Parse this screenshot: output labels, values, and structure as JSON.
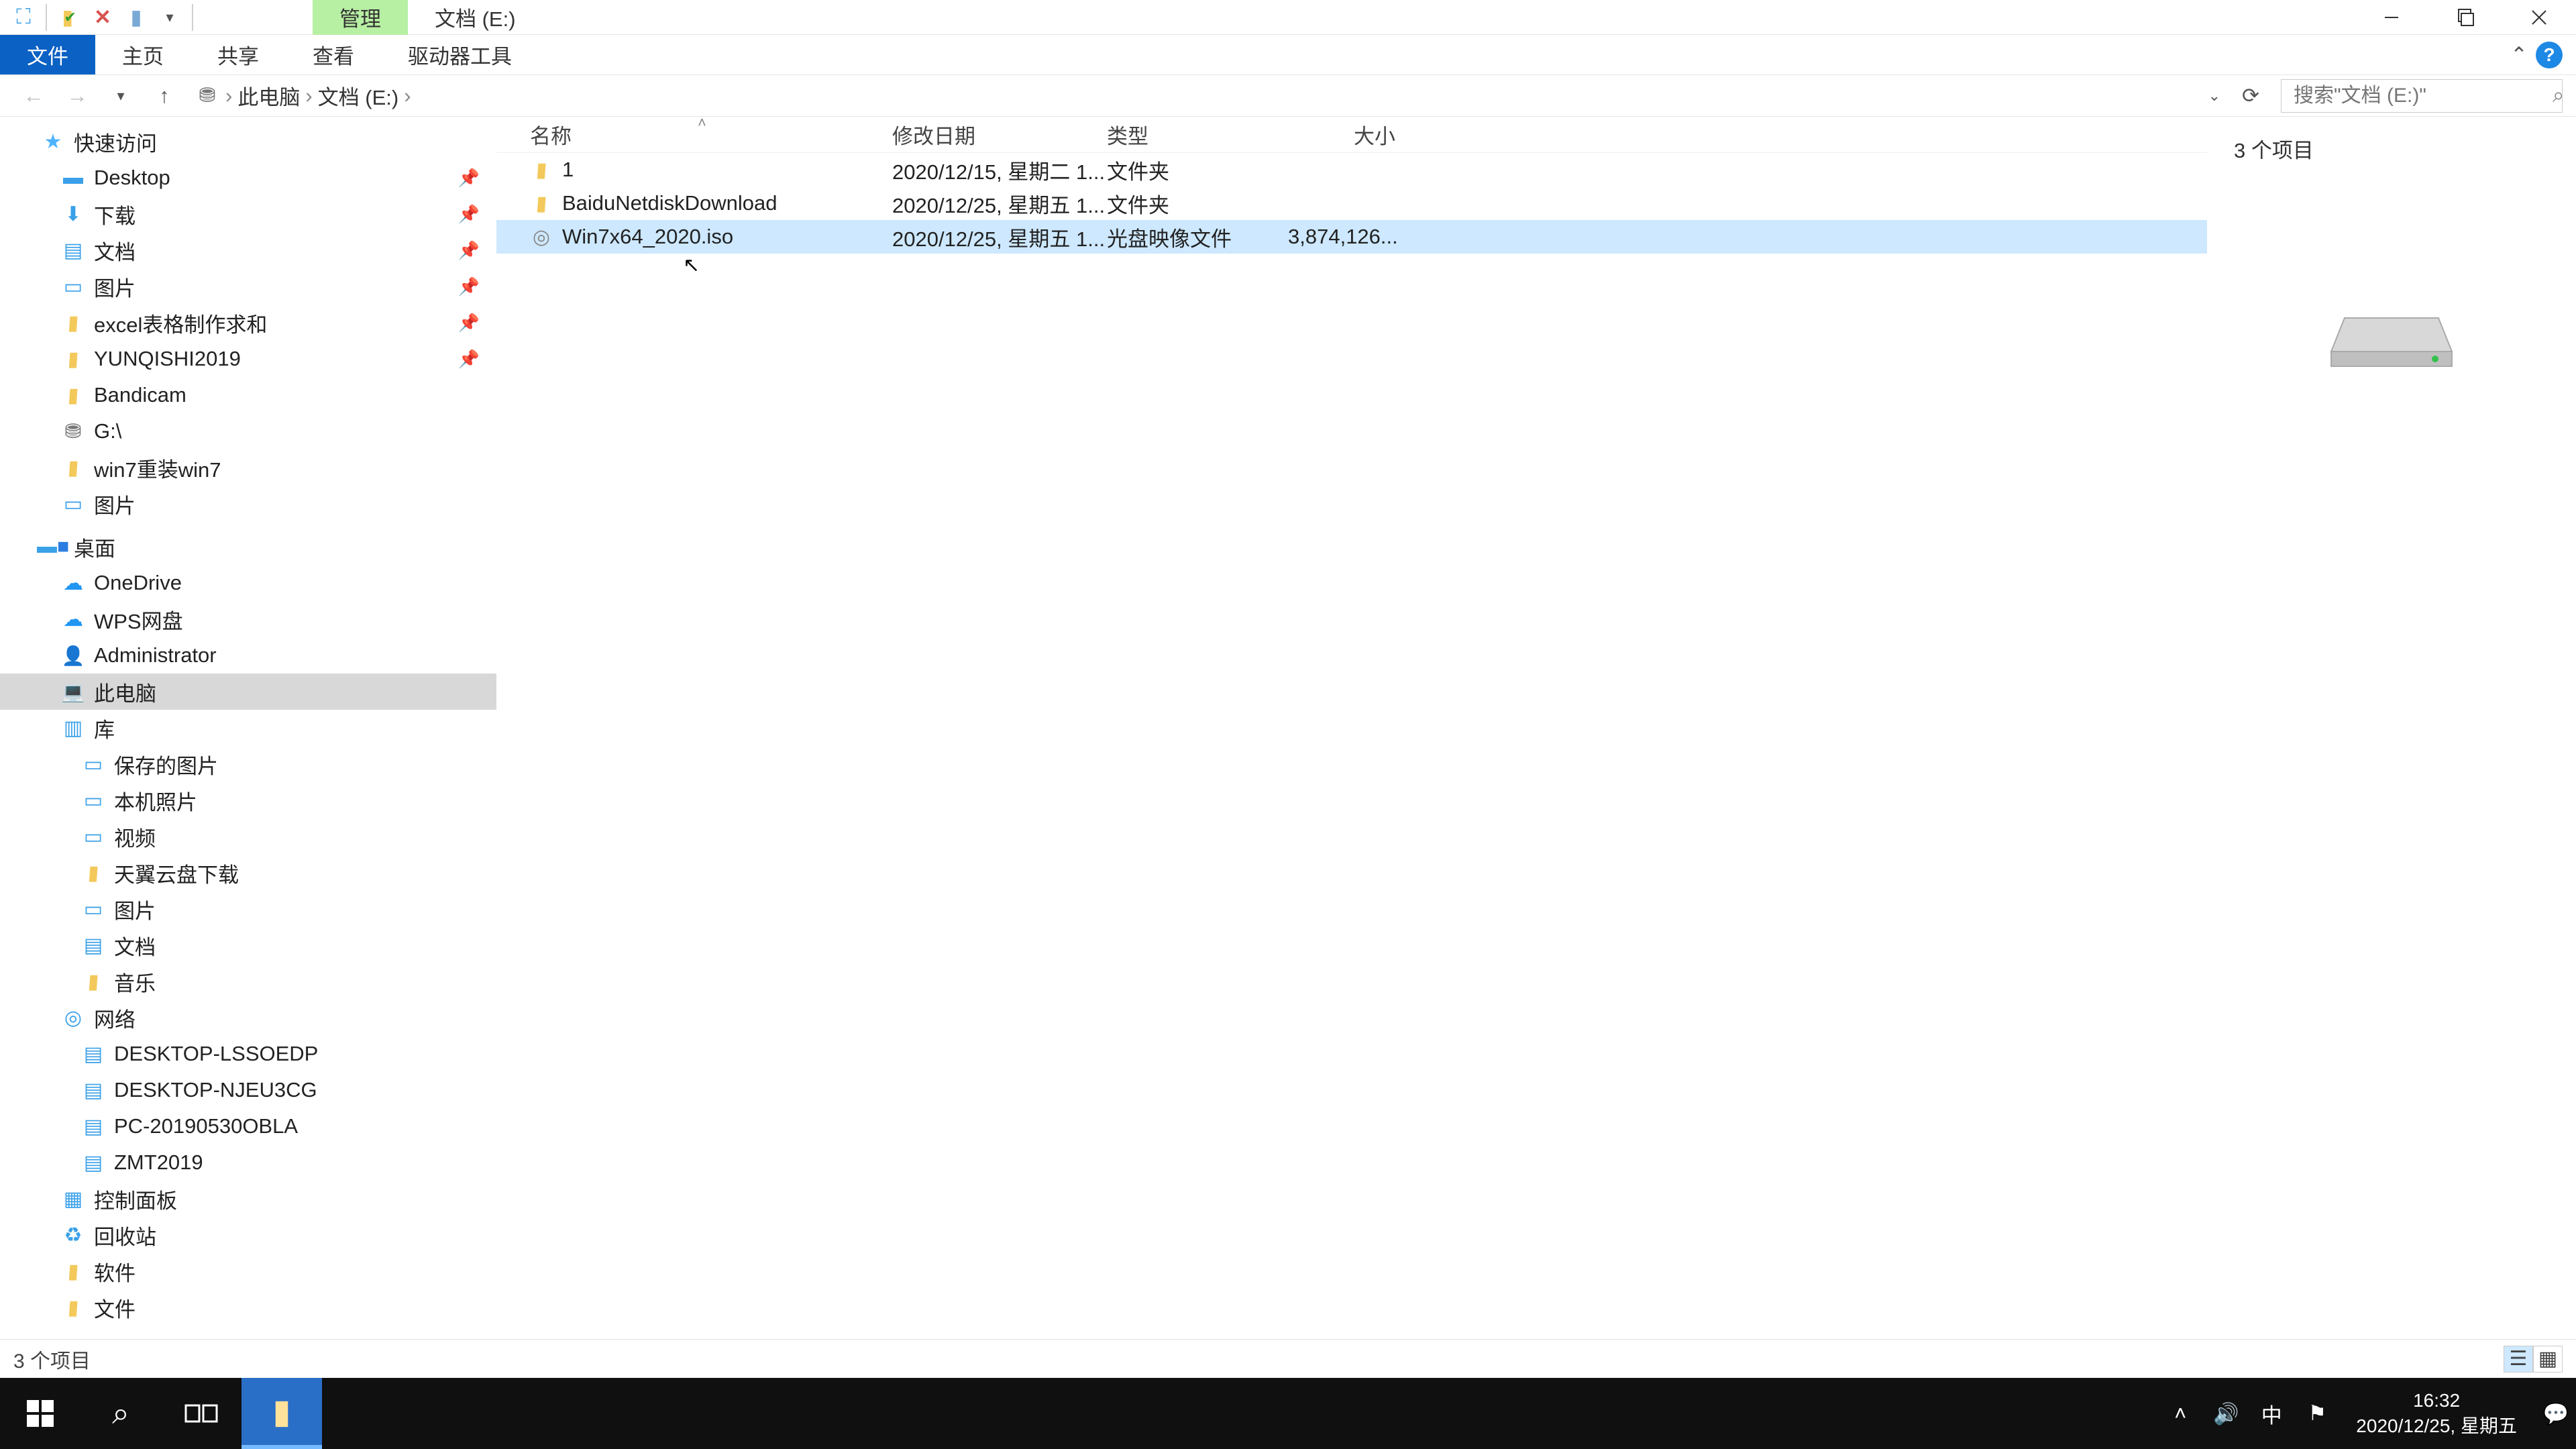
{
  "titlebar": {
    "context_tab": "管理",
    "title": "文档 (E:)"
  },
  "ribbon": {
    "file": "文件",
    "home": "主页",
    "share": "共享",
    "view": "查看",
    "drive_tools": "驱动器工具"
  },
  "address": {
    "crumbs": [
      "此电脑",
      "文档 (E:)"
    ],
    "search_placeholder": "搜索\"文档 (E:)\""
  },
  "nav": {
    "quick_access": "快速访问",
    "quick_items": [
      {
        "icon": "ico-desktop",
        "label": "Desktop",
        "pinned": true
      },
      {
        "icon": "ico-down",
        "label": "下载",
        "pinned": true
      },
      {
        "icon": "ico-doc",
        "label": "文档",
        "pinned": true
      },
      {
        "icon": "ico-pic",
        "label": "图片",
        "pinned": true
      },
      {
        "icon": "ico-folder",
        "label": "excel表格制作求和",
        "pinned": true
      },
      {
        "icon": "ico-folder",
        "label": "YUNQISHI2019",
        "pinned": true
      },
      {
        "icon": "ico-folder",
        "label": "Bandicam",
        "pinned": false
      },
      {
        "icon": "ico-drive",
        "label": "G:\\",
        "pinned": false
      },
      {
        "icon": "ico-folder",
        "label": "win7重装win7",
        "pinned": false
      },
      {
        "icon": "ico-pic",
        "label": "图片",
        "pinned": false
      }
    ],
    "desktop": "桌面",
    "desktop_items": [
      {
        "icon": "ico-onedrive",
        "label": "OneDrive"
      },
      {
        "icon": "ico-wps",
        "label": "WPS网盘"
      },
      {
        "icon": "ico-user",
        "label": "Administrator"
      },
      {
        "icon": "ico-pc",
        "label": "此电脑",
        "selected": true
      },
      {
        "icon": "ico-lib",
        "label": "库"
      }
    ],
    "lib_items": [
      {
        "icon": "ico-pic",
        "label": "保存的图片"
      },
      {
        "icon": "ico-pic",
        "label": "本机照片"
      },
      {
        "icon": "ico-pic",
        "label": "视频"
      },
      {
        "icon": "ico-folder",
        "label": "天翼云盘下载"
      },
      {
        "icon": "ico-pic",
        "label": "图片"
      },
      {
        "icon": "ico-doc",
        "label": "文档"
      },
      {
        "icon": "ico-folder",
        "label": "音乐"
      }
    ],
    "network": "网络",
    "net_items": [
      {
        "icon": "ico-netpc",
        "label": "DESKTOP-LSSOEDP"
      },
      {
        "icon": "ico-netpc",
        "label": "DESKTOP-NJEU3CG"
      },
      {
        "icon": "ico-netpc",
        "label": "PC-20190530OBLA"
      },
      {
        "icon": "ico-netpc",
        "label": "ZMT2019"
      }
    ],
    "tail_items": [
      {
        "icon": "ico-panel",
        "label": "控制面板"
      },
      {
        "icon": "ico-recycle",
        "label": "回收站"
      },
      {
        "icon": "ico-folder",
        "label": "软件"
      },
      {
        "icon": "ico-folder",
        "label": "文件"
      }
    ]
  },
  "columns": {
    "name": "名称",
    "date": "修改日期",
    "type": "类型",
    "size": "大小"
  },
  "rows": [
    {
      "icon": "ico-folder",
      "name": "1",
      "date": "2020/12/15, 星期二 1...",
      "type": "文件夹",
      "size": "",
      "selected": false
    },
    {
      "icon": "ico-folder",
      "name": "BaiduNetdiskDownload",
      "date": "2020/12/25, 星期五 1...",
      "type": "文件夹",
      "size": "",
      "selected": false
    },
    {
      "icon": "ico-iso",
      "name": "Win7x64_2020.iso",
      "date": "2020/12/25, 星期五 1...",
      "type": "光盘映像文件",
      "size": "3,874,126...",
      "selected": true
    }
  ],
  "preview": {
    "count": "3 个项目"
  },
  "status": {
    "text": "3 个项目"
  },
  "taskbar": {
    "time": "16:32",
    "date": "2020/12/25, 星期五",
    "ime": "中"
  }
}
